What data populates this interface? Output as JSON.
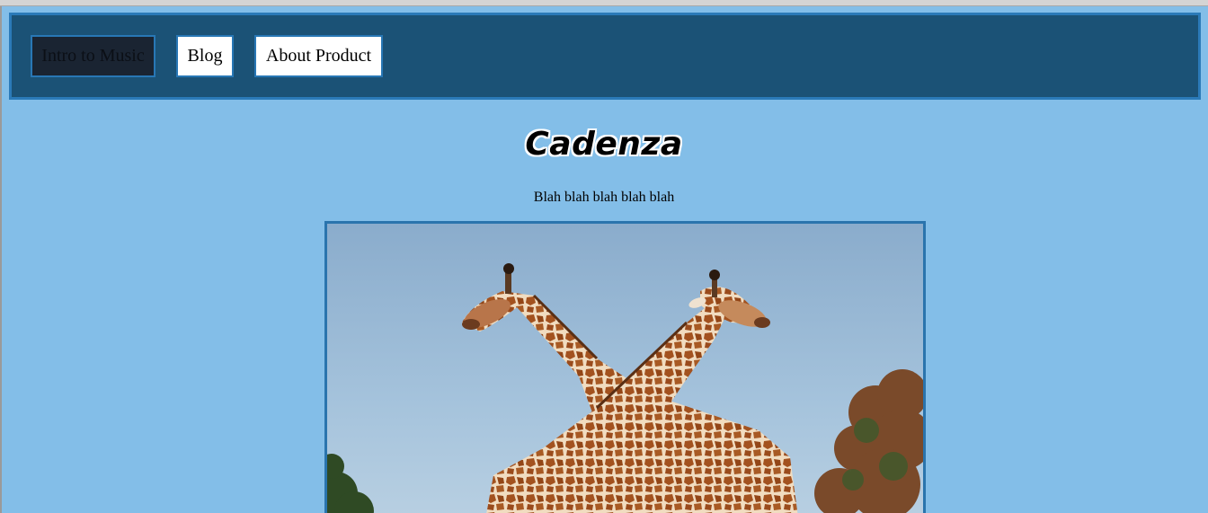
{
  "nav": {
    "items": [
      {
        "label": "Intro to Music",
        "active": true
      },
      {
        "label": "Blog",
        "active": false
      },
      {
        "label": "About Product",
        "active": false
      }
    ]
  },
  "page": {
    "title": "Cadenza",
    "subtitle": "Blah blah blah blah blah"
  },
  "colors": {
    "page_background": "#83bee8",
    "navbar_background": "#1b5276",
    "navbar_border": "#2b7ab8",
    "active_tab": "#1a2432",
    "image_border": "#2a74ad"
  },
  "image": {
    "subject": "two giraffes with crossed necks against a blue sky"
  }
}
